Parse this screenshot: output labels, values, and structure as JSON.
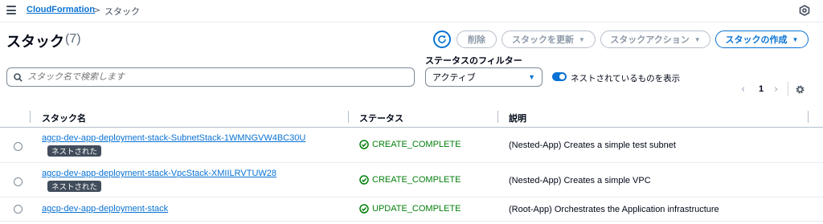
{
  "breadcrumb": {
    "service": "CloudFormation",
    "separator": ">",
    "current": "スタック"
  },
  "header": {
    "title": "スタック",
    "count": "(7)"
  },
  "toolbar": {
    "delete_label": "削除",
    "update_label": "スタックを更新",
    "actions_label": "スタックアクション",
    "create_label": "スタックの作成",
    "caret": "▼"
  },
  "filters": {
    "search_placeholder": "スタック名で検索します",
    "status_filter_label": "ステータスのフィルター",
    "status_selected": "アクティブ",
    "nested_toggle_label": "ネストされているものを表示",
    "nested_toggle_on": true
  },
  "pagination": {
    "prev": "‹",
    "page": "1",
    "next": "›"
  },
  "table": {
    "columns": [
      "スタック名",
      "ステータス",
      "説明"
    ],
    "rows": [
      {
        "name": "agcp-dev-app-deployment-stack-SubnetStack-1WMNGVW4BC30U",
        "badge": "ネストされた",
        "status": "CREATE_COMPLETE",
        "description": "(Nested-App) Creates a simple test subnet"
      },
      {
        "name": "agcp-dev-app-deployment-stack-VpcStack-XMIILRVTUW28",
        "badge": "ネストされた",
        "status": "CREATE_COMPLETE",
        "description": "(Nested-App) Creates a simple VPC"
      },
      {
        "name": "agcp-dev-app-deployment-stack",
        "badge": "",
        "status": "UPDATE_COMPLETE",
        "description": "(Root-App) Orchestrates the Application infrastructure"
      }
    ]
  },
  "colors": {
    "accent": "#0972d3",
    "success": "#037f0c",
    "badge_bg": "#414d5c"
  }
}
